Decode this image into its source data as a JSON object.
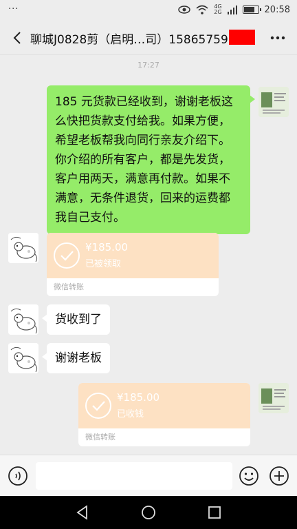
{
  "status_bar": {
    "dots": "···",
    "network_top": "4G",
    "network_bottom": "2G",
    "battery_level": 0.7,
    "time": "20:58"
  },
  "header": {
    "title": "聊城J0828剪（启明…司）15865759",
    "back_icon": "chevron-left-icon",
    "more_icon": "ellipsis-icon"
  },
  "chat": {
    "timestamp": "17:27",
    "messages": [
      {
        "from": "me",
        "type": "text",
        "lines": [
          "185 元货款已经收到，谢谢老板这",
          "么快把货款支付给我。如果方便，",
          "希望老板帮我向同行亲友介绍下。",
          "你介绍的所有客户，都是先发货，",
          "客户用两天，满意再付款。如果不",
          "满意，无条件退货，回来的运费都",
          "我自己支付。"
        ]
      },
      {
        "from": "them",
        "type": "transfer",
        "amount": "¥185.00",
        "status": "已被领取",
        "footer": "微信转账"
      },
      {
        "from": "them",
        "type": "text",
        "text": "货收到了"
      },
      {
        "from": "them",
        "type": "text",
        "text": "谢谢老板"
      },
      {
        "from": "me",
        "type": "transfer",
        "amount": "¥185.00",
        "status": "已收钱",
        "footer": "微信转账"
      }
    ]
  },
  "input_bar": {
    "voice_icon": "voice-icon",
    "emoji_icon": "emoji-icon",
    "plus_icon": "plus-icon",
    "placeholder": ""
  },
  "colors": {
    "my_bubble": "#95ec69",
    "their_bubble": "#ffffff",
    "transfer_bg": "#fde1c3",
    "background": "#ededed"
  }
}
